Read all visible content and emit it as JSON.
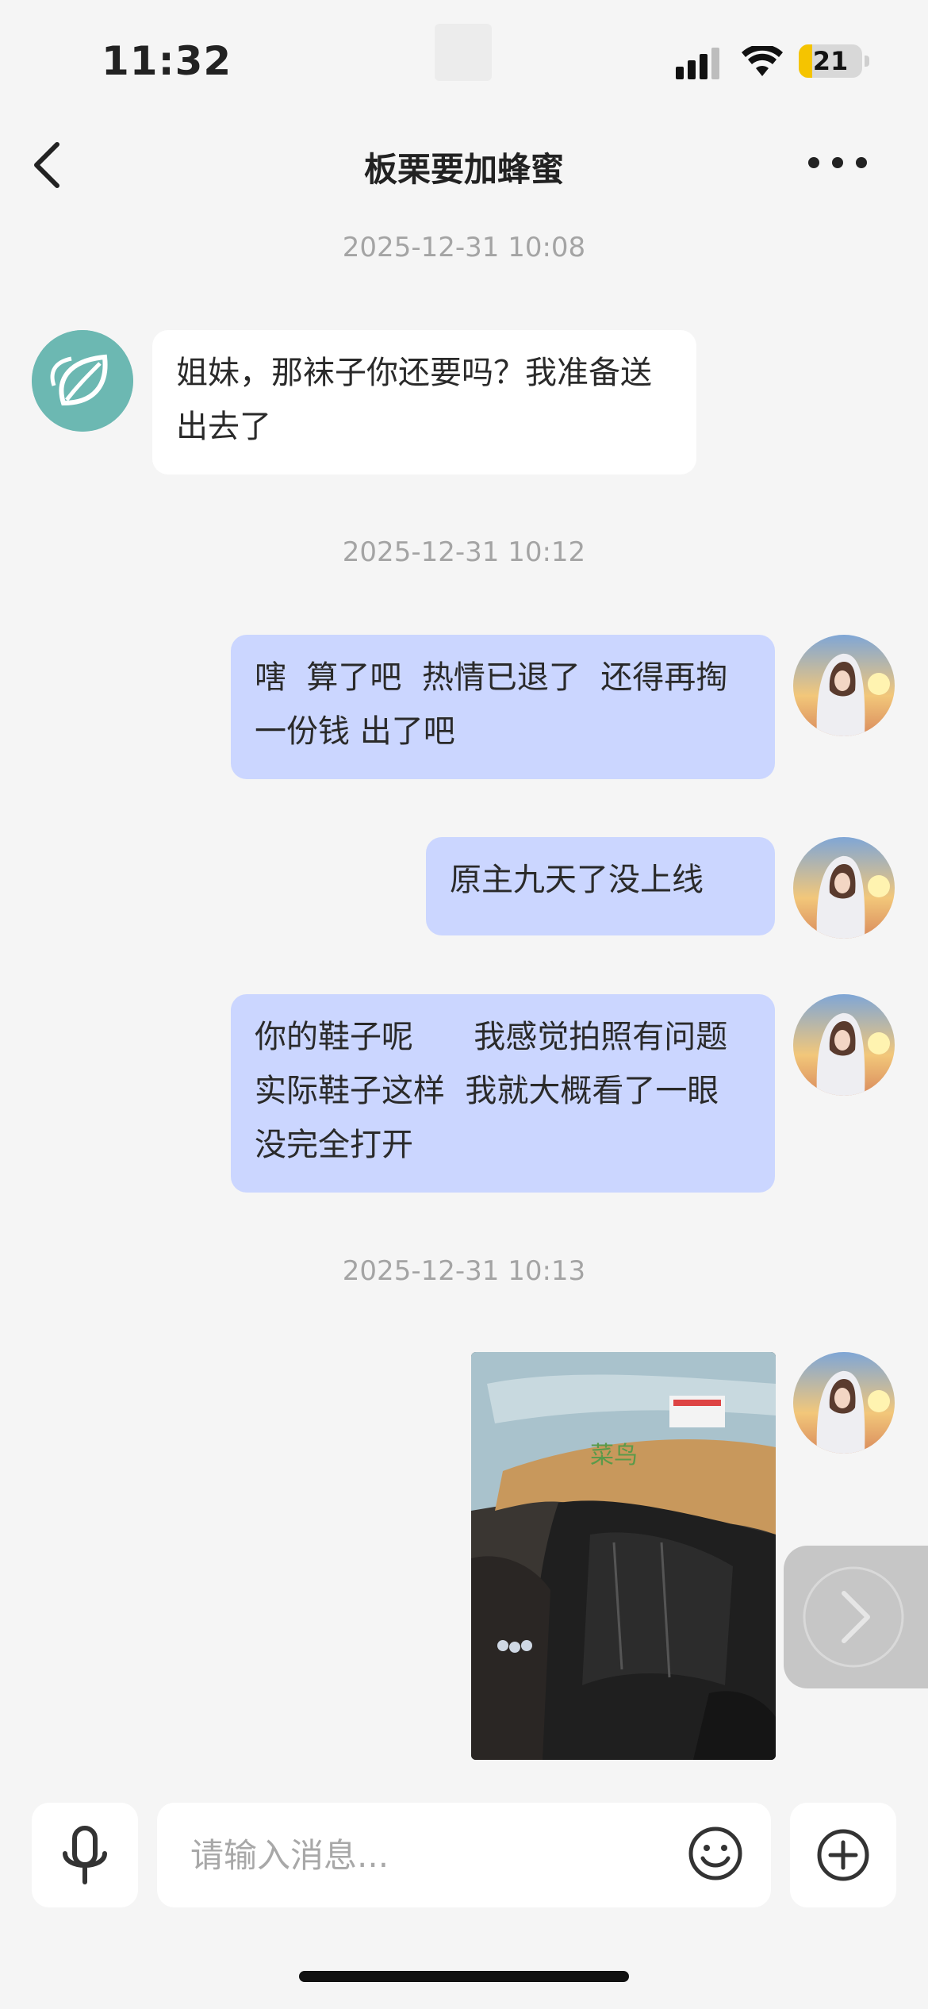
{
  "status_bar": {
    "time": "11:32",
    "battery": "21",
    "battery_level": 0.21
  },
  "header": {
    "title": "板栗要加蜂蜜"
  },
  "messages": [
    {
      "type": "timestamp",
      "text": "2025-12-31 10:08"
    },
    {
      "type": "incoming",
      "text": "姐妹，那袜子你还要吗？我准备送出去了"
    },
    {
      "type": "timestamp",
      "text": "2025-12-31 10:12"
    },
    {
      "type": "outgoing",
      "text": "嗐  算了吧  热情已退了  还得再掏一份钱 出了吧"
    },
    {
      "type": "outgoing",
      "text": "原主九天了没上线"
    },
    {
      "type": "outgoing",
      "text": "你的鞋子呢      我感觉拍照有问题    实际鞋子这样  我就大概看了一眼 没完全打开"
    },
    {
      "type": "timestamp",
      "text": "2025-12-31 10:13"
    },
    {
      "type": "outgoing_image"
    }
  ],
  "input": {
    "placeholder": "请输入消息..."
  },
  "colors": {
    "outgoing_bubble": "#cbd6ff",
    "incoming_bubble": "#ffffff",
    "background": "#f5f5f5",
    "incoming_avatar": "#6cb8b2"
  }
}
